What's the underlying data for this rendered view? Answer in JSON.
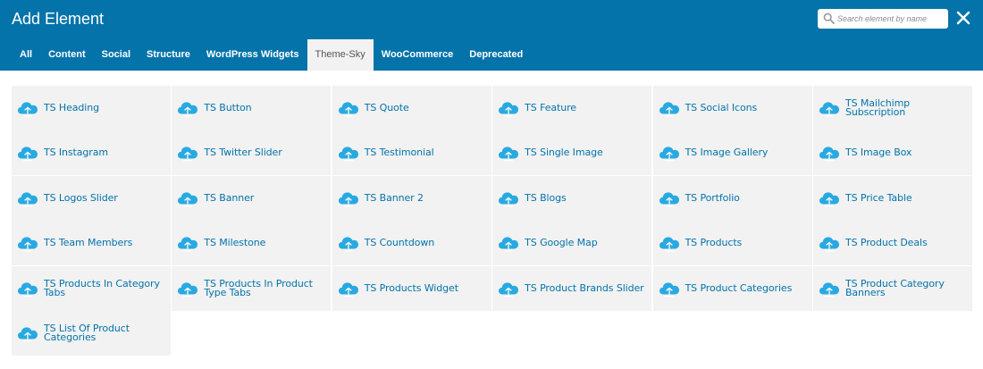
{
  "header": {
    "title": "Add Element",
    "search_placeholder": "Search element by name",
    "search_icon": "search-icon",
    "close_icon": "close-icon",
    "background_color": "#0473aa"
  },
  "tabs": [
    {
      "label": "All"
    },
    {
      "label": "Content"
    },
    {
      "label": "Social"
    },
    {
      "label": "Structure"
    },
    {
      "label": "WordPress Widgets"
    },
    {
      "label": "Theme-Sky",
      "active": true
    },
    {
      "label": "WooCommerce"
    },
    {
      "label": "Deprecated"
    }
  ],
  "element_icon": "cloud-icon",
  "accent_color": "#0473aa",
  "elements": [
    {
      "label": "TS Heading"
    },
    {
      "label": "TS Button"
    },
    {
      "label": "TS Quote"
    },
    {
      "label": "TS Feature"
    },
    {
      "label": "TS Social Icons"
    },
    {
      "label": "TS Mailchimp Subscription"
    },
    {
      "label": "TS Instagram"
    },
    {
      "label": "TS Twitter Slider"
    },
    {
      "label": "TS Testimonial"
    },
    {
      "label": "TS Single Image"
    },
    {
      "label": "TS Image Gallery"
    },
    {
      "label": "TS Image Box"
    },
    {
      "label": "TS Logos Slider"
    },
    {
      "label": "TS Banner"
    },
    {
      "label": "TS Banner 2"
    },
    {
      "label": "TS Blogs"
    },
    {
      "label": "TS Portfolio"
    },
    {
      "label": "TS Price Table"
    },
    {
      "label": "TS Team Members"
    },
    {
      "label": "TS Milestone"
    },
    {
      "label": "TS Countdown"
    },
    {
      "label": "TS Google Map"
    },
    {
      "label": "TS Products"
    },
    {
      "label": "TS Product Deals"
    },
    {
      "label": "TS Products In Category Tabs"
    },
    {
      "label": "TS Products In Product Type Tabs"
    },
    {
      "label": "TS Products Widget"
    },
    {
      "label": "TS Product Brands Slider"
    },
    {
      "label": "TS Product Categories"
    },
    {
      "label": "TS Product Category Banners"
    },
    {
      "label": "TS List Of Product Categories"
    }
  ]
}
